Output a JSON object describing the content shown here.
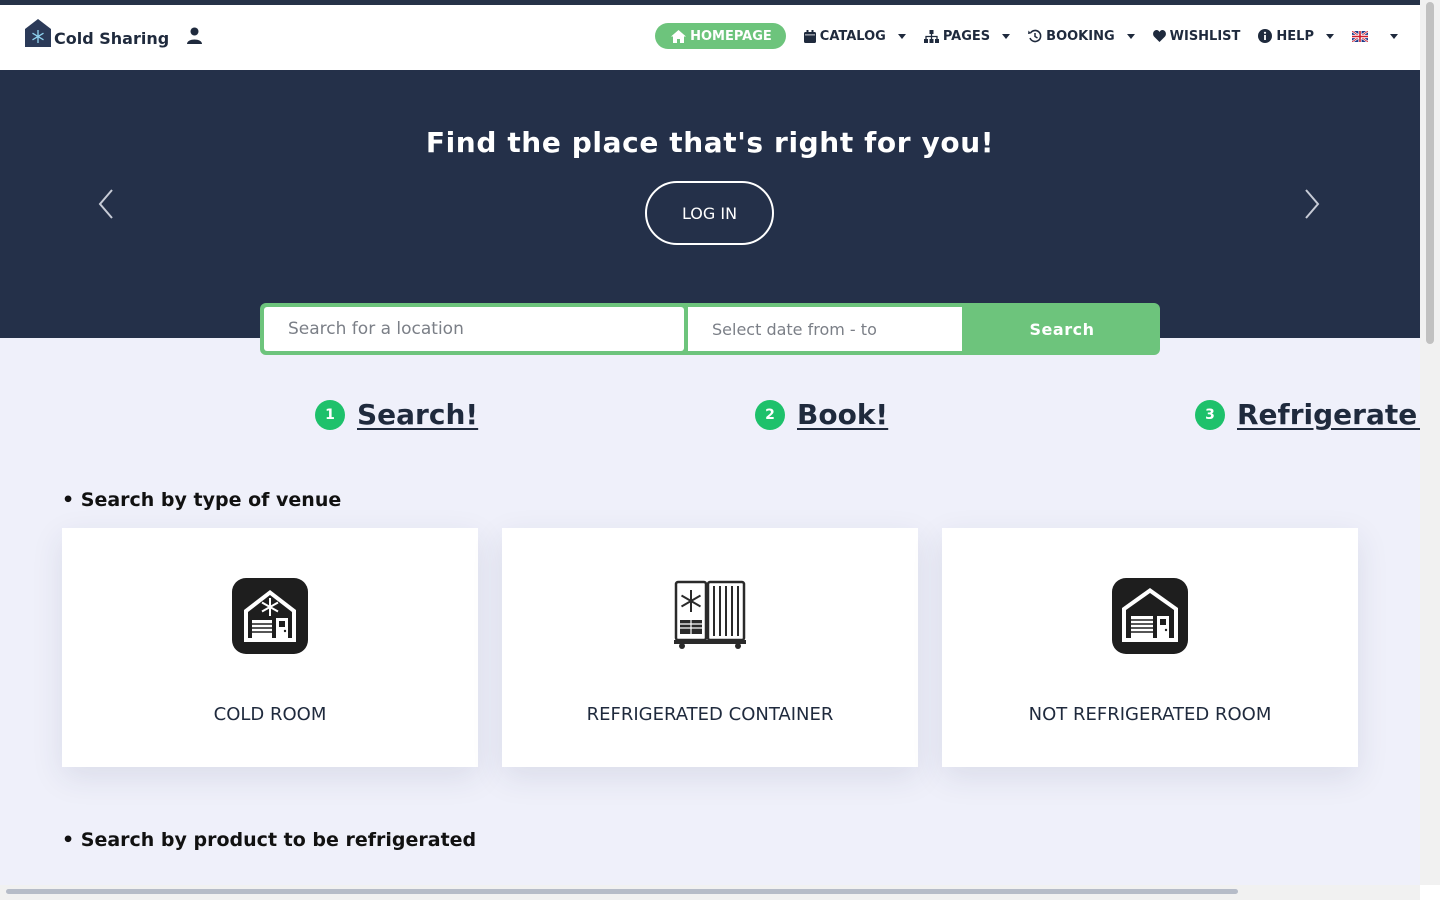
{
  "header": {
    "brand_name": "Cold Sharing",
    "brand_icon": "snowflake-house-icon",
    "user_icon": "user-icon",
    "menu": {
      "homepage": "HOMEPAGE",
      "catalog": "CATALOG",
      "pages": "PAGES",
      "booking": "BOOKING",
      "wishlist": "WISHLIST",
      "help": "HELP"
    },
    "language_flag": "uk-flag-icon"
  },
  "hero": {
    "title": "Find the place that's right for you!",
    "login_label": "LOG IN"
  },
  "search": {
    "location_placeholder": "Search for a location",
    "date_placeholder": "Select date from - to",
    "button_label": "Search"
  },
  "steps": [
    {
      "number": "1",
      "label": "Search!"
    },
    {
      "number": "2",
      "label": "Book!"
    },
    {
      "number": "3",
      "label": "Refrigerate!"
    }
  ],
  "venue_section": {
    "title": "• Search by type of venue",
    "cards": [
      {
        "label": "COLD ROOM",
        "icon": "cold-room-icon"
      },
      {
        "label": "REFRIGERATED CONTAINER",
        "icon": "refrigerated-container-icon"
      },
      {
        "label": "NOT REFRIGERATED ROOM",
        "icon": "not-refrigerated-room-icon"
      }
    ]
  },
  "product_section": {
    "title": "• Search by product to be refrigerated"
  },
  "colors": {
    "primary_dark": "#243049",
    "accent_green": "#6dc47c",
    "step_green": "#1ec16b",
    "background": "#eff0fa"
  }
}
